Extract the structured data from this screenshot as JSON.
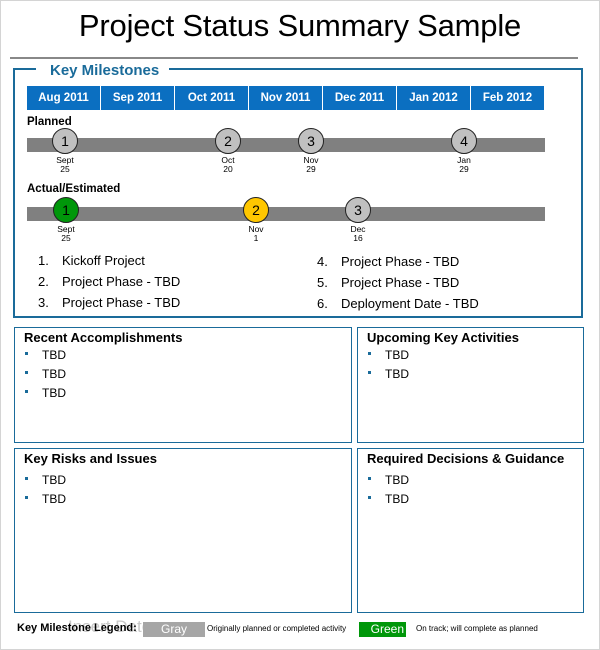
{
  "title": "Project Status Summary Sample",
  "milestones": {
    "heading": "Key Milestones",
    "months": [
      "Aug 2011",
      "Sep 2011",
      "Oct 2011",
      "Nov 2011",
      "Dec 2011",
      "Jan 2012",
      "Feb 2012"
    ],
    "planned": {
      "label": "Planned",
      "points": [
        {
          "num": "1",
          "month": "Sept",
          "day": "25",
          "status": "gray"
        },
        {
          "num": "2",
          "month": "Oct",
          "day": "20",
          "status": "gray"
        },
        {
          "num": "3",
          "month": "Nov",
          "day": "29",
          "status": "gray"
        },
        {
          "num": "4",
          "month": "Jan",
          "day": "29",
          "status": "gray"
        }
      ]
    },
    "actual": {
      "label": "Actual/Estimated",
      "points": [
        {
          "num": "1",
          "month": "Sept",
          "day": "25",
          "status": "green"
        },
        {
          "num": "2",
          "month": "Nov",
          "day": "1",
          "status": "yellow"
        },
        {
          "num": "3",
          "month": "Dec",
          "day": "16",
          "status": "gray"
        }
      ]
    },
    "list": [
      {
        "num": "1.",
        "text": "Kickoff Project"
      },
      {
        "num": "2.",
        "text": "Project Phase - TBD"
      },
      {
        "num": "3.",
        "text": "Project Phase - TBD"
      },
      {
        "num": "4.",
        "text": "Project Phase - TBD"
      },
      {
        "num": "5.",
        "text": "Project Phase - TBD"
      },
      {
        "num": "6.",
        "text": "Deployment Date - TBD"
      }
    ]
  },
  "panels": {
    "accomplishments": {
      "title": "Recent Accomplishments",
      "items": [
        "TBD",
        "TBD",
        "TBD"
      ]
    },
    "upcoming": {
      "title": "Upcoming Key Activities",
      "items": [
        "TBD",
        "TBD"
      ]
    },
    "risks": {
      "title": "Key Risks and Issues",
      "items": [
        "TBD",
        "TBD"
      ]
    },
    "decisions": {
      "title": "Required Decisions & Guidance",
      "items": [
        "TBD",
        "TBD"
      ]
    }
  },
  "legend": {
    "label": "Key Milestone Legend:",
    "ghost_text": "Insert Date",
    "gray": {
      "swatch": "Gray",
      "text": "Originally planned or completed activity"
    },
    "green": {
      "swatch": "Green",
      "text": "On track; will complete as planned"
    }
  },
  "colors": {
    "accent": "#1a6b9a",
    "month_header": "#0b6fc1",
    "gray": "#c0c0c0",
    "green": "#00970a",
    "yellow": "#ffc700",
    "bar": "#808080"
  }
}
